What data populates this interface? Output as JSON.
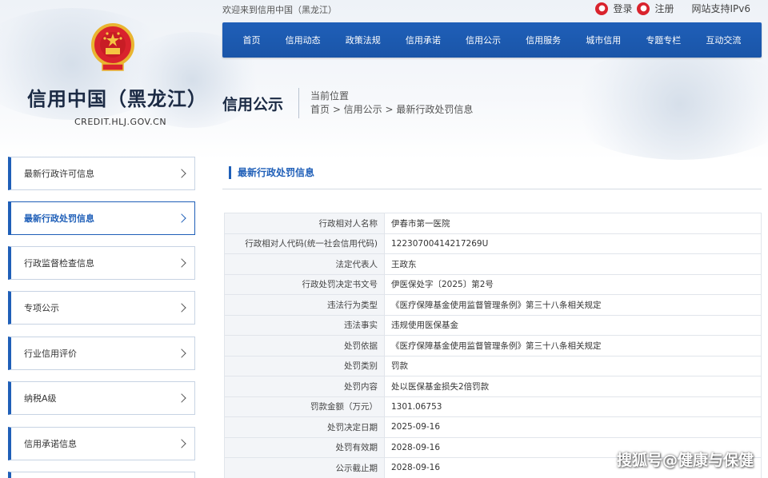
{
  "header": {
    "welcome": "欢迎来到信用中国（黑龙江）",
    "login": "登录",
    "register": "注册",
    "ipv6": "网站支持IPv6"
  },
  "nav": [
    "首页",
    "信用动态",
    "政策法规",
    "信用承诺",
    "信用公示",
    "信用服务",
    "城市信用",
    "专题专栏",
    "互动交流"
  ],
  "site": {
    "title": "信用中国（黑龙江）",
    "domain": "CREDIT.HLJ.GOV.CN"
  },
  "section": {
    "title": "信用公示",
    "position_label": "当前位置",
    "breadcrumb": "首页 > 信用公示 > 最新行政处罚信息"
  },
  "sidebar": [
    {
      "label": "最新行政许可信息",
      "active": false
    },
    {
      "label": "最新行政处罚信息",
      "active": true
    },
    {
      "label": "行政监督检查信息",
      "active": false
    },
    {
      "label": "专项公示",
      "active": false
    },
    {
      "label": "行业信用评价",
      "active": false
    },
    {
      "label": "纳税A级",
      "active": false
    },
    {
      "label": "信用承诺信息",
      "active": false
    }
  ],
  "content": {
    "title": "最新行政处罚信息",
    "rows": [
      {
        "key": "行政相对人名称",
        "value": "伊春市第一医院"
      },
      {
        "key": "行政相对人代码(统一社会信用代码)",
        "value": "12230700414217269U"
      },
      {
        "key": "法定代表人",
        "value": "王政东"
      },
      {
        "key": "行政处罚决定书文号",
        "value": "伊医保处字〔2025〕第2号"
      },
      {
        "key": "违法行为类型",
        "value": "《医疗保障基金使用监督管理条例》第三十八条相关规定"
      },
      {
        "key": "违法事实",
        "value": "违规使用医保基金"
      },
      {
        "key": "处罚依据",
        "value": "《医疗保障基金使用监督管理条例》第三十八条相关规定"
      },
      {
        "key": "处罚类别",
        "value": "罚款"
      },
      {
        "key": "处罚内容",
        "value": "处以医保基金损失2倍罚款"
      },
      {
        "key": "罚款金额（万元）",
        "value": "1301.06753"
      },
      {
        "key": "处罚决定日期",
        "value": "2025-09-16"
      },
      {
        "key": "处罚有效期",
        "value": "2028-09-16"
      },
      {
        "key": "公示截止期",
        "value": "2028-09-16"
      }
    ]
  },
  "watermark": "搜狐号@健康与保健",
  "colors": {
    "primary": "#1f5fb8",
    "nav_bg": "#1a55a8",
    "accent_red": "#d9232d"
  }
}
